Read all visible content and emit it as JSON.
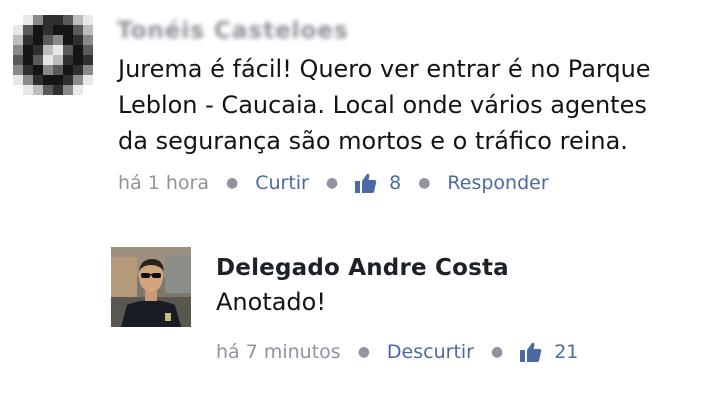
{
  "comments": [
    {
      "author": "Tonéis Casteloes",
      "text_lines": [
        "Jurema é fácil! Quero ver entrar é no Parque",
        "Leblon - Caucaia. Local onde vários agentes",
        "da segurança são mortos e o tráfico reina."
      ],
      "time": "há 1 hora",
      "action": "Curtir",
      "likes": "8",
      "reply": "Responder"
    },
    {
      "author": "Delegado Andre Costa",
      "text_lines": [
        "Anotado!"
      ],
      "time": "há 7 minutos",
      "action": "Descurtir",
      "likes": "21"
    }
  ],
  "colors": {
    "link": "#4b6aa3",
    "meta": "#90949c",
    "text": "#141414"
  },
  "icons": {
    "like": "thumbs-up-icon"
  }
}
